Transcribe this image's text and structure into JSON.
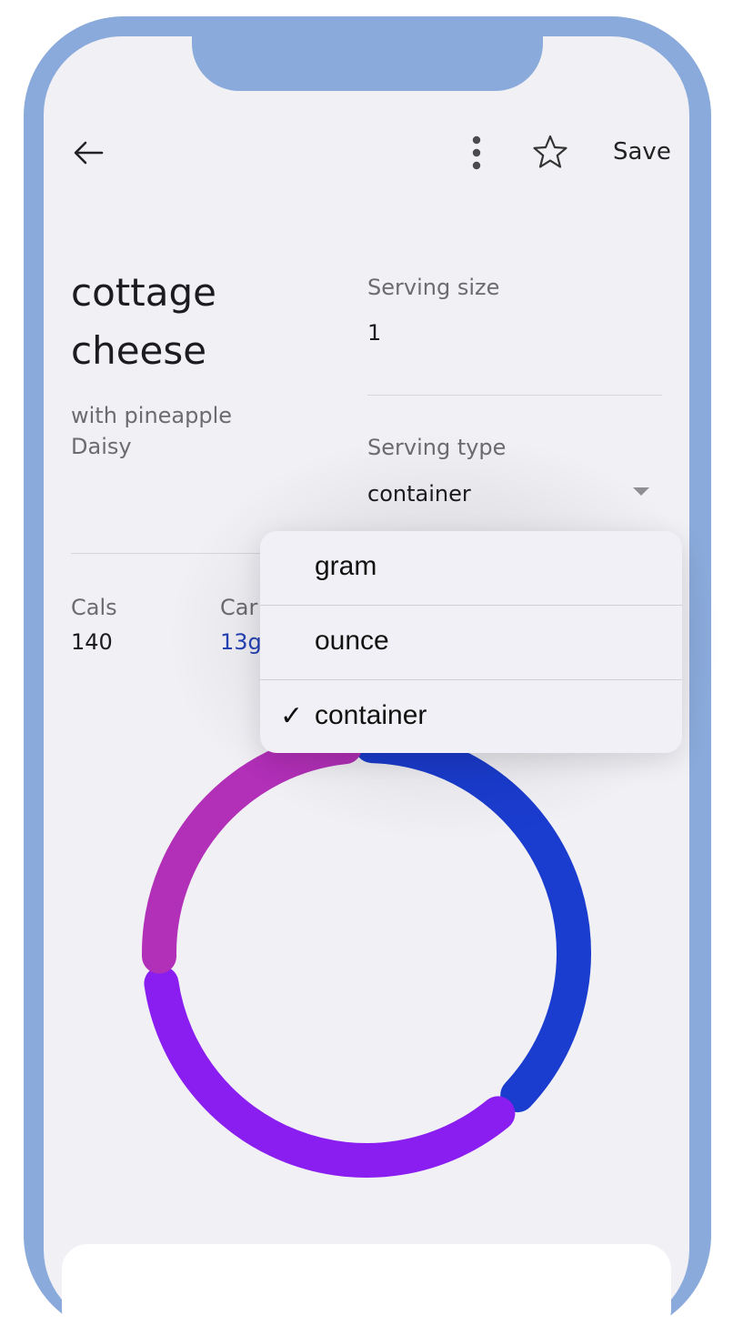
{
  "app_bar": {
    "back_icon": "arrow-left-icon",
    "more_icon": "more-vertical-icon",
    "star_icon": "star-outline-icon",
    "save_label": "Save"
  },
  "food": {
    "name_line1": "cottage",
    "name_line2": "cheese",
    "description": "with pineapple",
    "brand": "Daisy"
  },
  "serving": {
    "size_label": "Serving size",
    "size_value": "1",
    "type_label": "Serving type",
    "type_value": "container"
  },
  "nutrition": {
    "cals_label": "Cals",
    "cals_value": "140",
    "carbs_label_partial": "Car",
    "carbs_value_partial": "13g"
  },
  "serving_type_menu": {
    "options": [
      "gram",
      "ounce",
      "container"
    ],
    "selected": "container",
    "check_glyph": "✓"
  },
  "colors": {
    "frame": "#8aaadb",
    "ring_magenta": "#b22fb8",
    "ring_blue": "#1a3ccf",
    "ring_purple": "#8a1ef0",
    "link_blue": "#2442b8"
  },
  "macro_ring": {
    "segments": [
      {
        "color": "#1a3ccf",
        "fraction": 0.37
      },
      {
        "color": "#8a1ef0",
        "fraction": 0.34
      },
      {
        "color": "#b22fb8",
        "fraction": 0.24
      }
    ]
  }
}
